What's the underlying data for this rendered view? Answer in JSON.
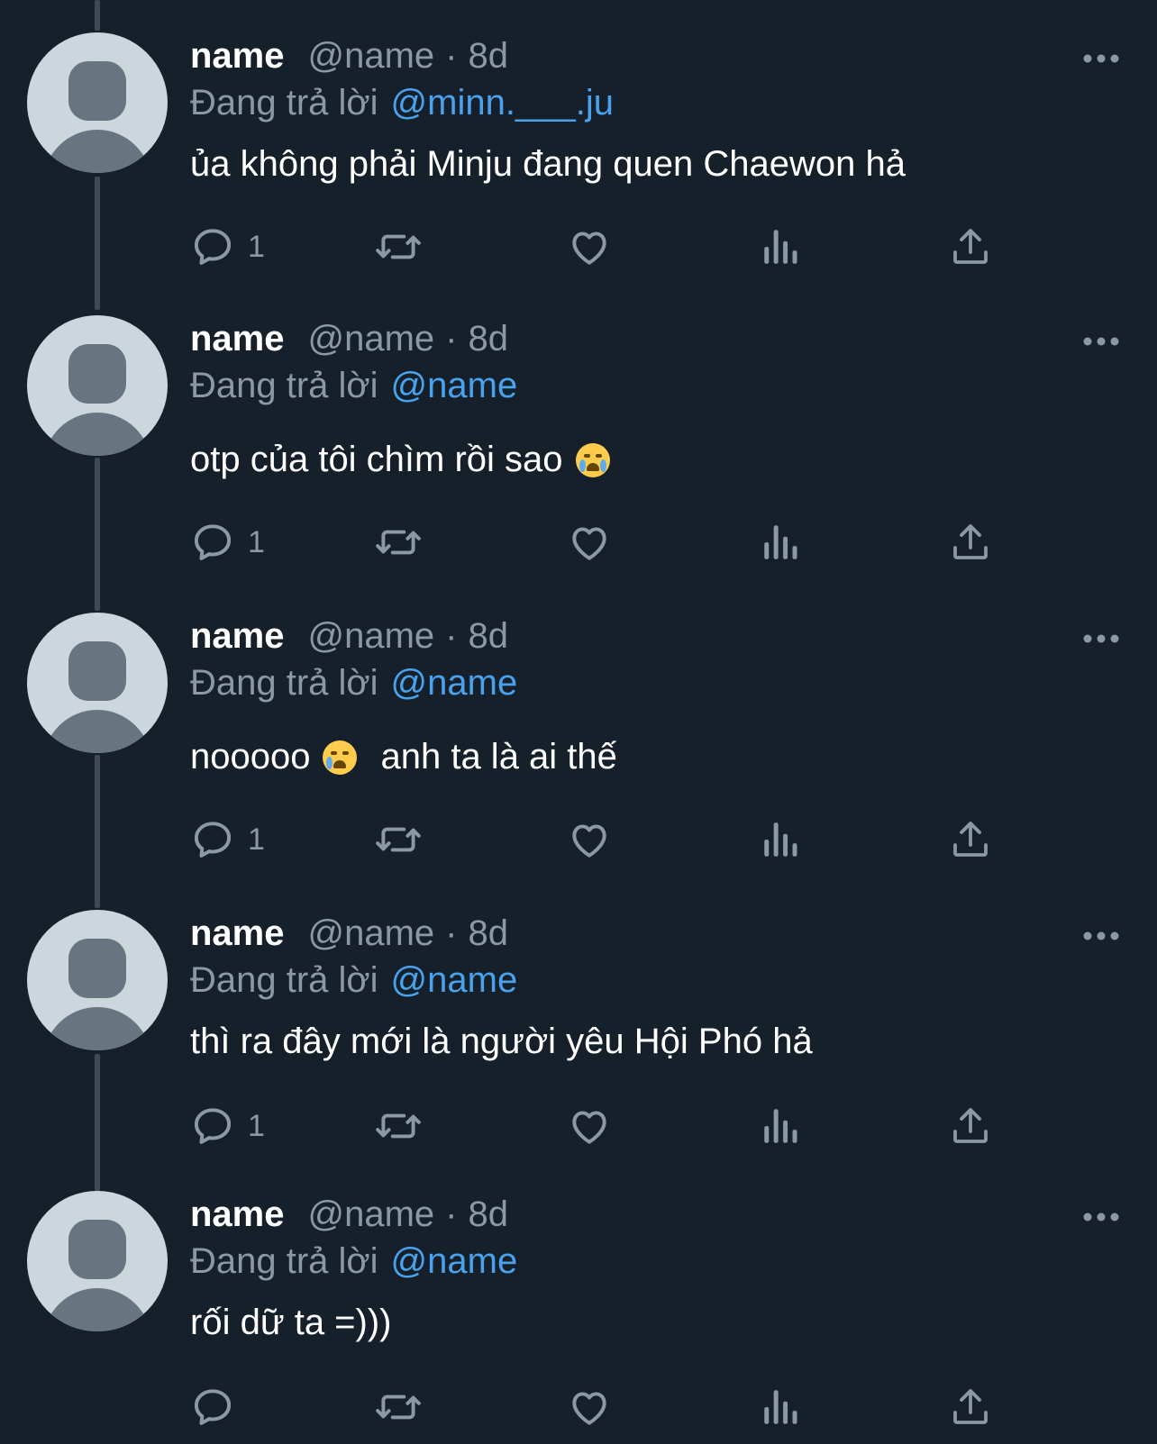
{
  "colors": {
    "background": "#15202b",
    "secondary_text": "#8b98a5",
    "mention": "#4aa1ec",
    "avatar_bg": "#ccd6dd",
    "avatar_fg": "#66757f"
  },
  "tweets": [
    {
      "name": "name",
      "handle": "@name",
      "separator": "·",
      "time": "8d",
      "replying_label": "Đang trả lời",
      "replying_to": "@minn.___.ju",
      "text_parts": [
        "ủa không phải Minju đang quen Chaewon hả"
      ],
      "emoji": "",
      "reply_count": "1"
    },
    {
      "name": "name",
      "handle": "@name",
      "separator": "·",
      "time": "8d",
      "replying_label": "Đang trả lời",
      "replying_to": "@name",
      "text_parts": [
        "otp của tôi chìm rồi sao",
        ""
      ],
      "emoji": "loudly-crying-face",
      "reply_count": "1"
    },
    {
      "name": "name",
      "handle": "@name",
      "separator": "·",
      "time": "8d",
      "replying_label": "Đang trả lời",
      "replying_to": "@name",
      "text_parts": [
        "nooooo",
        "anh ta là ai thế"
      ],
      "emoji": "crying-face",
      "reply_count": "1"
    },
    {
      "name": "name",
      "handle": "@name",
      "separator": "·",
      "time": "8d",
      "replying_label": "Đang trả lời",
      "replying_to": "@name",
      "text_parts": [
        "thì ra đây mới là người yêu Hội Phó hả"
      ],
      "emoji": "",
      "reply_count": "1"
    },
    {
      "name": "name",
      "handle": "@name",
      "separator": "·",
      "time": "8d",
      "replying_label": "Đang trả lời",
      "replying_to": "@name",
      "text_parts": [
        "rối dữ ta =)))"
      ],
      "emoji": "",
      "reply_count": ""
    }
  ],
  "icons": {
    "reply": "reply-bubble-icon",
    "retweet": "retweet-icon",
    "like": "heart-icon",
    "views": "views-chart-icon",
    "share": "share-upload-icon",
    "more": "more-dots-icon"
  }
}
